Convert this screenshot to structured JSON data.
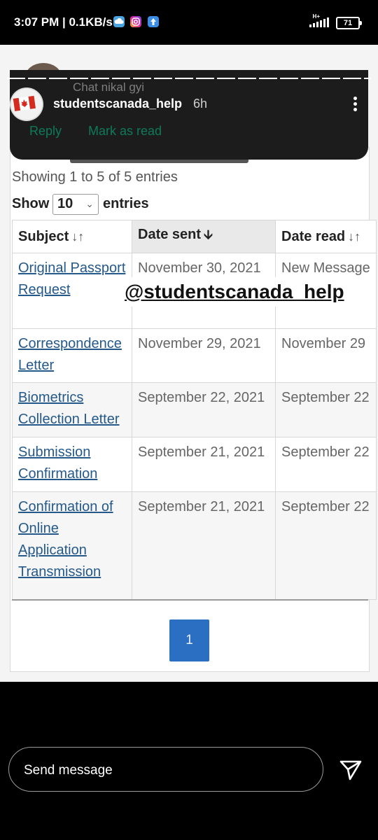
{
  "status_bar": {
    "time_speed": "3:07 PM | 0.1KB/s",
    "network_label": "H+",
    "battery": "71",
    "icons": [
      "cloud-icon",
      "instagram-icon",
      "upload-icon",
      "signal-icon",
      "battery-icon"
    ]
  },
  "story": {
    "username": "studentscanada_help",
    "time_ago": "6h",
    "reply_preview": "Chat nikal gyi",
    "reply_label": "Reply",
    "mark_read_label": "Mark as read",
    "accent": "#0f7a5a"
  },
  "page": {
    "showing_text": "Showing 1 to 5 of 5 entries",
    "show_label": "Show",
    "page_size": "10",
    "entries_label": "entries",
    "columns": [
      "Subject",
      "Date sent",
      "Date read"
    ],
    "rows": [
      {
        "subject": "Original Passport Request",
        "sent": "November 30, 2021",
        "read": "New Message"
      },
      {
        "subject": "Correspondence Letter",
        "sent": "November 29, 2021",
        "read": "November 29"
      },
      {
        "subject": "Biometrics Collection Letter",
        "sent": "September 22, 2021",
        "read": "September 22"
      },
      {
        "subject": "Submission Confirmation",
        "sent": "September 21, 2021",
        "read": "September 22"
      },
      {
        "subject": "Confirmation of Online Application Transmission",
        "sent": "September 21, 2021",
        "read": "September 22"
      }
    ],
    "current_page": "1",
    "link_color": "#24598a",
    "button_color": "#2a6fc1"
  },
  "watermark": "@studentscanada_help",
  "composer": {
    "placeholder": "Send message"
  }
}
